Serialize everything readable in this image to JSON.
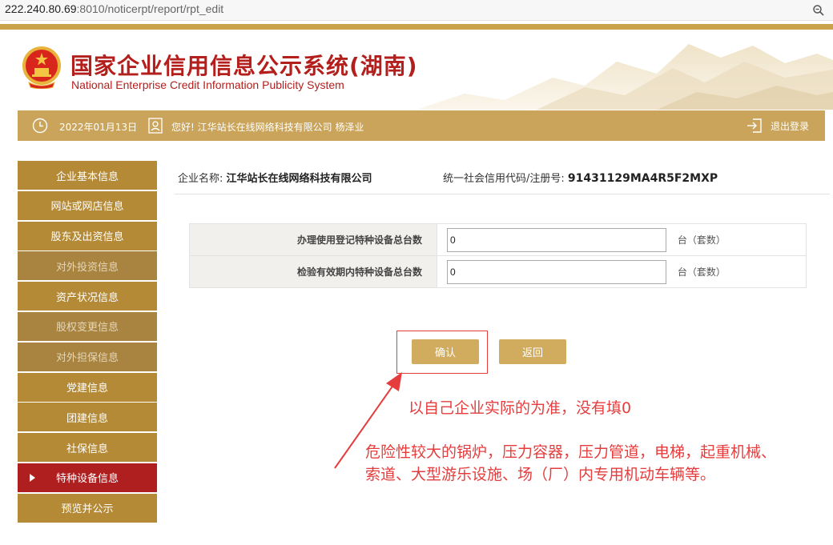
{
  "browser": {
    "url_host": "222.240.80.69",
    "url_path": ":8010/noticerpt/report/rpt_edit",
    "zoom_icon": "zoom-icon"
  },
  "header": {
    "title": "国家企业信用信息公示系统(湖南)",
    "subtitle": "National Enterprise Credit Information Publicity System"
  },
  "info_bar": {
    "date": "2022年01月13日",
    "greeting": "您好! 江华站长在线网络科技有限公司   杨泽业",
    "logout": "退出登录"
  },
  "sidebar": {
    "items": [
      {
        "label": "企业基本信息",
        "state": "normal"
      },
      {
        "label": "网站或网店信息",
        "state": "normal"
      },
      {
        "label": "股东及出资信息",
        "state": "normal"
      },
      {
        "label": "对外投资信息",
        "state": "disabled"
      },
      {
        "label": "资产状况信息",
        "state": "normal"
      },
      {
        "label": "股权变更信息",
        "state": "disabled"
      },
      {
        "label": "对外担保信息",
        "state": "disabled"
      },
      {
        "label": "党建信息",
        "state": "normal"
      },
      {
        "label": "团建信息",
        "state": "normal"
      },
      {
        "label": "社保信息",
        "state": "normal"
      },
      {
        "label": "特种设备信息",
        "state": "active"
      },
      {
        "label": "预览并公示",
        "state": "normal"
      }
    ]
  },
  "company": {
    "name_label": "企业名称:",
    "name": "江华站长在线网络科技有限公司",
    "code_label": "统一社会信用代码/注册号:",
    "code": "91431129MA4R5F2MXP"
  },
  "form": {
    "rows": [
      {
        "label": "办理使用登记特种设备总台数",
        "value": "0",
        "unit": "台（套数）"
      },
      {
        "label": "检验有效期内特种设备总台数",
        "value": "0",
        "unit": "台（套数）"
      }
    ],
    "confirm": "确认",
    "back": "返回"
  },
  "annotation": {
    "note1": "以自己企业实际的为准，没有填0",
    "note2_line1": "危险性较大的锅炉，压力容器，压力管道，电梯，起重机械、",
    "note2_line2": "索道、大型游乐设施、场（厂）内专用机动车辆等。",
    "color": "#e53d3d"
  },
  "colors": {
    "gold": "#c9a45a",
    "sidebar": "#b48a37",
    "active": "#b01f20",
    "title_red": "#b31f1c"
  }
}
